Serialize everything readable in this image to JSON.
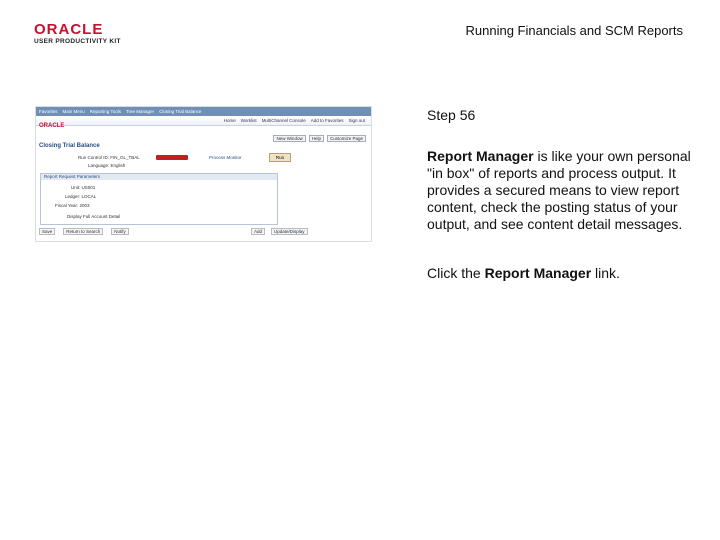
{
  "header": {
    "logo_text": "ORACLE",
    "logo_subtitle": "USER PRODUCTIVITY KIT",
    "title": "Running Financials and SCM Reports"
  },
  "step": {
    "label": "Step 56"
  },
  "description": {
    "term": "Report Manager",
    "text": " is like your own personal \"in box\" of reports and process output. It provides a secured means to view report content, check the posting status of your output, and see content detail messages."
  },
  "instruction": {
    "prefix": "Click the ",
    "link": "Report Manager",
    "suffix": " link."
  },
  "screenshot": {
    "nav_items": [
      "Favorites",
      "Main Menu",
      "Reporting Tools",
      "Tree Manager",
      "Closing Trial Balance"
    ],
    "util_links": [
      "Home",
      "Worklist",
      "MultiChannel Console",
      "Add to Favorites",
      "Sign out"
    ],
    "logo": "ORACLE",
    "links": [
      "New Window",
      "Help",
      "Customize Page"
    ],
    "page_title": "Closing Trial Balance",
    "run_control_label": "Run Control ID: FIN_GL_TBAL",
    "language_label": "Language: English",
    "process_monitor": "Process Monitor",
    "run_button": "Run",
    "panel_header": "Report Request Parameters",
    "fields": [
      "Unit: US001",
      "Ledger: LOCAL",
      "Fiscal Year: 2003",
      "Display Full Account Detail"
    ],
    "bottom_buttons": [
      "Save",
      "Return to Search",
      "Notify"
    ],
    "bottom_right": [
      "Add",
      "Update/Display"
    ]
  }
}
